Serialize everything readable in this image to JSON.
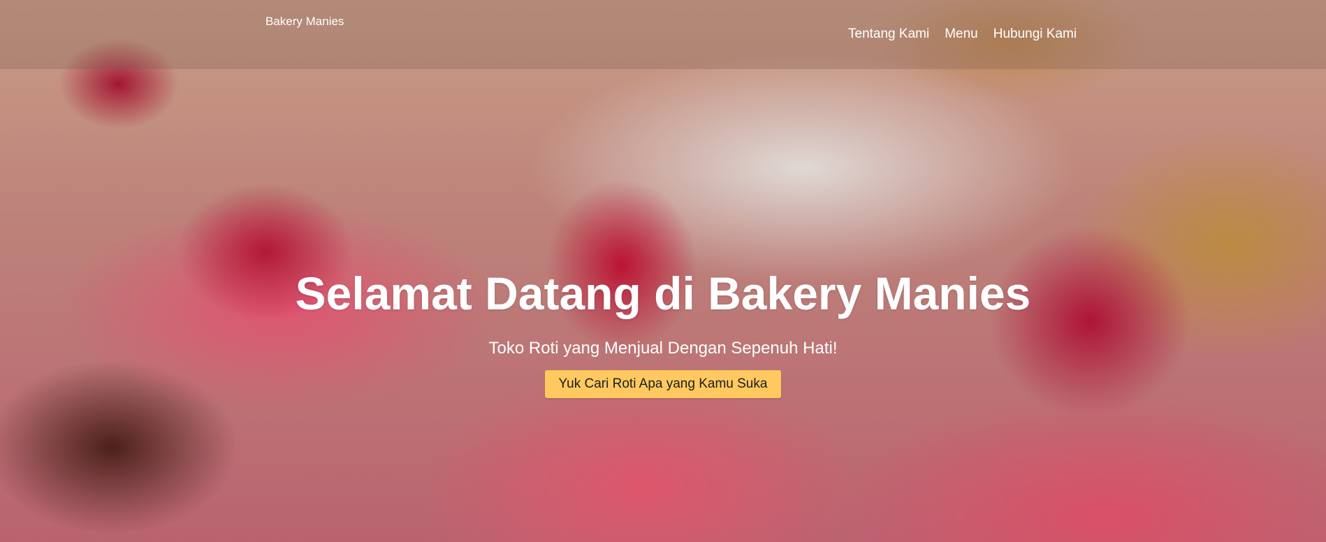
{
  "navbar": {
    "brand": "Bakery Manies",
    "links": [
      "Tentang Kami",
      "Menu",
      "Hubungi Kami"
    ]
  },
  "hero": {
    "title": "Selamat Datang di Bakery Manies",
    "subtitle": "Toko Roti yang Menjual Dengan Sepenuh Hati!",
    "cta_label": "Yuk Cari Roti Apa yang Kamu Suka",
    "cta_color": "#ffc960",
    "background_image": "macarons-with-raspberries"
  }
}
